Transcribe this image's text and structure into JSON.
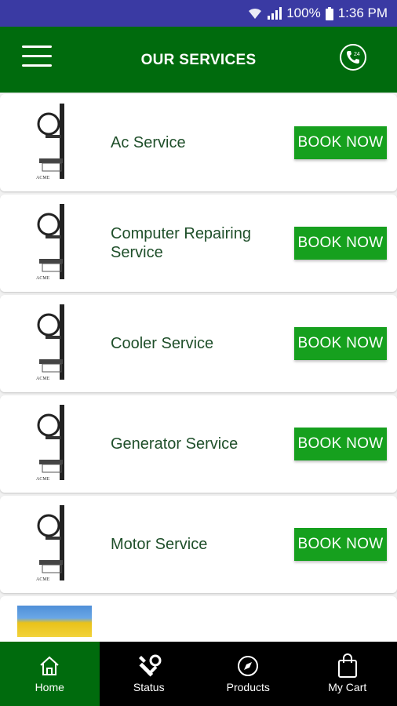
{
  "status_bar": {
    "battery": "100%",
    "time": "1:36 PM"
  },
  "header": {
    "title": "OUR SERVICES",
    "menu_icon": "hamburger-menu-icon",
    "call_icon": "phone-24-icon",
    "call_badge": "24"
  },
  "services": [
    {
      "name": "Ac Service",
      "button": "BOOK NOW"
    },
    {
      "name": "Computer Repairing Service",
      "button": "BOOK NOW"
    },
    {
      "name": "Cooler Service",
      "button": "BOOK NOW"
    },
    {
      "name": "Generator Service",
      "button": "BOOK NOW"
    },
    {
      "name": "Motor Service",
      "button": "BOOK NOW"
    }
  ],
  "bottom_nav": [
    {
      "label": "Home",
      "icon": "home-icon",
      "active": true
    },
    {
      "label": "Status",
      "icon": "tools-icon",
      "active": false
    },
    {
      "label": "Products",
      "icon": "compass-icon",
      "active": false
    },
    {
      "label": "My Cart",
      "icon": "shopping-bag-icon",
      "active": false
    }
  ],
  "colors": {
    "primary": "#006b0d",
    "button": "#16a01e",
    "status_bar": "#3a3aa3",
    "nav_bg": "#000000"
  }
}
